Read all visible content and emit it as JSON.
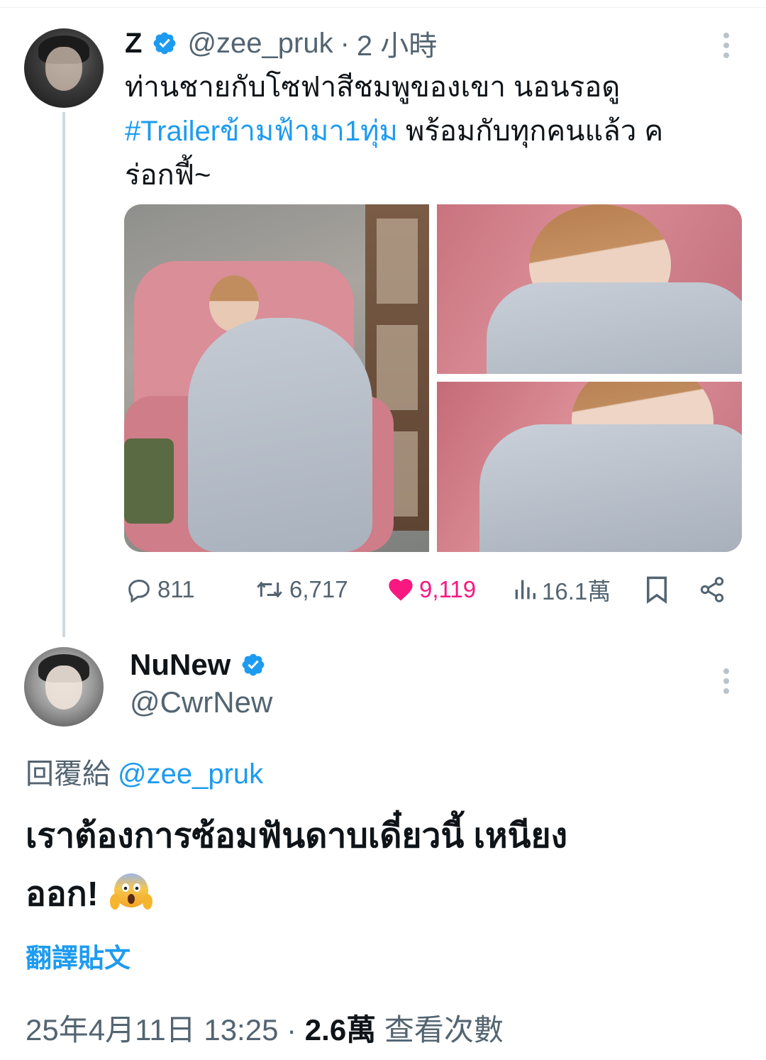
{
  "parent_tweet": {
    "display_name": "Z",
    "handle": "@zee_pruk",
    "separator": "·",
    "time": "2 小時",
    "text_line1": "ท่านชายกับโซฟาสีชมพูของเขา นอนรอดู",
    "hashtag": "#Trailerข้ามฟ้ามา1ทุ่ม",
    "text_line2_rest": " พร้อมกับทุกคนแล้ว ค",
    "text_line3": "ร่อกฟี้~",
    "verified": true,
    "photos_count": 3,
    "actions": {
      "replies": "811",
      "reposts": "6,717",
      "likes": "9,119",
      "views": "16.1萬"
    }
  },
  "reply_tweet": {
    "display_name": "NuNew",
    "handle": "@CwrNew",
    "verified": true,
    "replying_to_label": "回覆給",
    "replying_to_handle": "@zee_pruk",
    "text_line1": "เราต้องการซ้อมฟันดาบเดี๋ยวนี้ เหนียง",
    "text_line2": "ออก!",
    "emoji": "face-screaming-in-fear",
    "translate_label": "翻譯貼文",
    "timestamp": "25年4月11日 13:25",
    "separator": "·",
    "views_count": "2.6萬",
    "views_label": "查看次數"
  },
  "colors": {
    "link_blue": "#1d9bf0",
    "like_pink": "#f91880",
    "secondary_text": "#536471",
    "primary_text": "#0f1419",
    "thread_line": "#cfd9de"
  }
}
